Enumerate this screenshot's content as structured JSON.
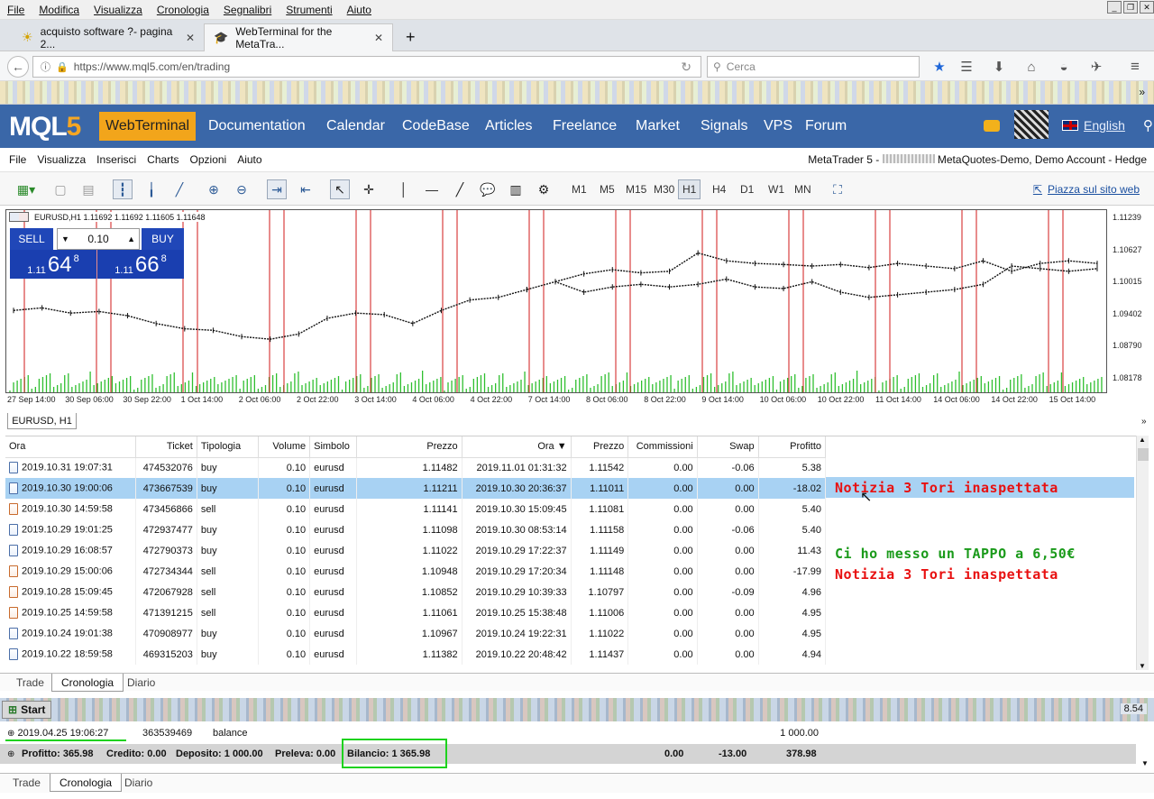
{
  "menu": {
    "items": [
      "File",
      "Modifica",
      "Visualizza",
      "Cronologia",
      "Segnalibri",
      "Strumenti",
      "Aiuto"
    ]
  },
  "tabs": [
    {
      "label": "acquisto software ?- pagina 2..."
    },
    {
      "label": "WebTerminal for the MetaTra..."
    }
  ],
  "nav": {
    "url": "https://www.mql5.com/en/trading",
    "search_placeholder": "Cerca"
  },
  "site": {
    "logo_main": "MQL",
    "logo_accent": "5",
    "items": [
      "WebTerminal",
      "Documentation",
      "Calendar",
      "CodeBase",
      "Articles",
      "Freelance",
      "Market",
      "Signals",
      "VPS",
      "Forum"
    ],
    "language": "English"
  },
  "terminal": {
    "menu": [
      "File",
      "Visualizza",
      "Inserisci",
      "Charts",
      "Opzioni",
      "Aiuto"
    ],
    "account_prefix": "MetaTrader 5 -",
    "account_suffix": "MetaQuotes-Demo, Demo Account - Hedge",
    "timeframes": [
      "M1",
      "M5",
      "M15",
      "M30",
      "H1",
      "H4",
      "D1",
      "W1",
      "MN"
    ],
    "active_timeframe": "H1",
    "place_link": "Piazza sul sito web"
  },
  "chart": {
    "header": "EURUSD,H1  1.11692 1.11692 1.11605 1.11648",
    "tab": "EURUSD, H1",
    "sell_label": "SELL",
    "buy_label": "BUY",
    "lot": "0.10",
    "sell_pre": "1.11",
    "sell_big": "64",
    "sell_sup": "8",
    "buy_pre": "1.11",
    "buy_big": "66",
    "buy_sup": "8"
  },
  "chart_data": {
    "type": "line",
    "title": "EURUSD,H1",
    "y_ticks": [
      "1.11239",
      "1.10627",
      "1.10015",
      "1.09402",
      "1.08790",
      "1.08178"
    ],
    "ylim": [
      1.079,
      1.1142
    ],
    "x_ticks": [
      "27 Sep 14:00",
      "30 Sep 06:00",
      "30 Sep 22:00",
      "1 Oct 14:00",
      "2 Oct 06:00",
      "2 Oct 22:00",
      "3 Oct 14:00",
      "4 Oct 06:00",
      "4 Oct 22:00",
      "7 Oct 14:00",
      "8 Oct 06:00",
      "8 Oct 22:00",
      "9 Oct 14:00",
      "10 Oct 06:00",
      "10 Oct 22:00",
      "11 Oct 14:00",
      "14 Oct 06:00",
      "14 Oct 22:00",
      "15 Oct 14:00"
    ],
    "x": [
      0,
      2,
      4,
      6,
      8,
      10,
      12,
      14,
      16,
      18,
      20,
      22,
      24,
      26,
      28,
      30,
      32,
      34,
      36,
      38,
      40,
      42,
      44,
      46,
      48,
      50,
      52,
      54,
      56,
      58,
      60,
      62,
      64,
      66,
      68,
      70,
      72,
      74,
      76
    ],
    "values": [
      1.095,
      1.0955,
      1.0945,
      1.0948,
      1.094,
      1.0925,
      1.0915,
      1.0912,
      1.09,
      1.0895,
      1.0905,
      1.0935,
      1.0945,
      1.0942,
      1.0925,
      1.095,
      1.097,
      1.0975,
      1.099,
      1.1005,
      1.0985,
      1.0995,
      1.1,
      1.0995,
      1.1,
      1.101,
      1.0995,
      1.0992,
      1.1005,
      1.0985,
      1.0975,
      1.098,
      1.0985,
      1.099,
      1.1,
      1.1035,
      1.103,
      1.1025,
      1.103
    ],
    "x2": [
      38,
      40,
      42,
      44,
      46,
      48,
      50,
      52,
      54,
      56,
      58,
      60,
      62,
      64,
      66,
      68,
      70,
      72,
      74,
      76
    ],
    "values2": [
      1.1005,
      1.102,
      1.1028,
      1.1022,
      1.1025,
      1.106,
      1.1045,
      1.104,
      1.1038,
      1.1035,
      1.1038,
      1.1032,
      1.104,
      1.1035,
      1.103,
      1.1045,
      1.1025,
      1.104,
      1.1045,
      1.104
    ],
    "grid": false
  },
  "history": {
    "headers": [
      "Ora",
      "Ticket",
      "Tipologia",
      "Volume",
      "Simbolo",
      "Prezzo",
      "Ora",
      "Prezzo",
      "Commissioni",
      "Swap",
      "Profitto"
    ],
    "rows": [
      [
        "2019.10.31 19:07:31",
        "474532076",
        "buy",
        "0.10",
        "eurusd",
        "1.11482",
        "2019.11.01 01:31:32",
        "1.11542",
        "0.00",
        "-0.06",
        "5.38"
      ],
      [
        "2019.10.30 19:00:06",
        "473667539",
        "buy",
        "0.10",
        "eurusd",
        "1.11211",
        "2019.10.30 20:36:37",
        "1.11011",
        "0.00",
        "0.00",
        "-18.02"
      ],
      [
        "2019.10.30 14:59:58",
        "473456866",
        "sell",
        "0.10",
        "eurusd",
        "1.11141",
        "2019.10.30 15:09:45",
        "1.11081",
        "0.00",
        "0.00",
        "5.40"
      ],
      [
        "2019.10.29 19:01:25",
        "472937477",
        "buy",
        "0.10",
        "eurusd",
        "1.11098",
        "2019.10.30 08:53:14",
        "1.11158",
        "0.00",
        "-0.06",
        "5.40"
      ],
      [
        "2019.10.29 16:08:57",
        "472790373",
        "buy",
        "0.10",
        "eurusd",
        "1.11022",
        "2019.10.29 17:22:37",
        "1.11149",
        "0.00",
        "0.00",
        "11.43"
      ],
      [
        "2019.10.29 15:00:06",
        "472734344",
        "sell",
        "0.10",
        "eurusd",
        "1.10948",
        "2019.10.29 17:20:34",
        "1.11148",
        "0.00",
        "0.00",
        "-17.99"
      ],
      [
        "2019.10.28 15:09:45",
        "472067928",
        "sell",
        "0.10",
        "eurusd",
        "1.10852",
        "2019.10.29 10:39:33",
        "1.10797",
        "0.00",
        "-0.09",
        "4.96"
      ],
      [
        "2019.10.25 14:59:58",
        "471391215",
        "sell",
        "0.10",
        "eurusd",
        "1.11061",
        "2019.10.25 15:38:48",
        "1.11006",
        "0.00",
        "0.00",
        "4.95"
      ],
      [
        "2019.10.24 19:01:38",
        "470908977",
        "buy",
        "0.10",
        "eurusd",
        "1.10967",
        "2019.10.24 19:22:31",
        "1.11022",
        "0.00",
        "0.00",
        "4.95"
      ],
      [
        "2019.10.22 18:59:58",
        "469315203",
        "buy",
        "0.10",
        "eurusd",
        "1.11382",
        "2019.10.22 20:48:42",
        "1.11437",
        "0.00",
        "0.00",
        "4.94"
      ]
    ],
    "notes": [
      "Notizia 3 Tori inaspettata",
      "Ci ho messo un TAPPO a 6,50€",
      "Notizia 3 Tori inaspettata"
    ],
    "note_colors": [
      "#e81010",
      "#1a9a1a",
      "#e81010"
    ]
  },
  "bottom_tabs": [
    "Trade",
    "Cronologia",
    "Diario"
  ],
  "taskbar": {
    "start": "Start",
    "clock": "8.54"
  },
  "balance_row": {
    "time": "2019.04.25 19:06:27",
    "ticket": "363539469",
    "type": "balance",
    "amount": "1 000.00"
  },
  "summary": {
    "profit": "Profitto: 365.98",
    "credit": "Credito: 0.00",
    "deposit": "Deposito: 1 000.00",
    "withdraw": "Preleva: 0.00",
    "balance": "Bilancio: 1 365.98",
    "commissions": "0.00",
    "swap": "-13.00",
    "total": "378.98"
  }
}
